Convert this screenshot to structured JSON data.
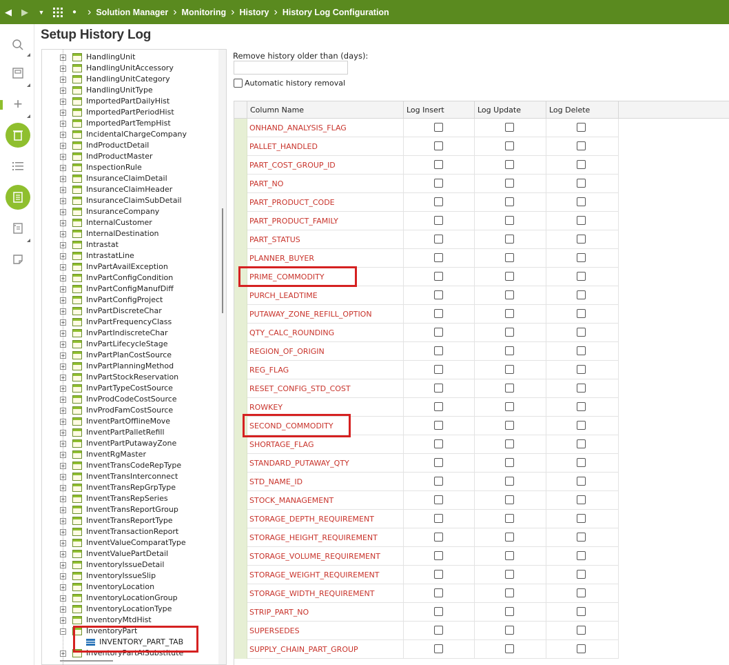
{
  "breadcrumb": [
    "Solution Manager",
    "Monitoring",
    "History",
    "History Log Configuration"
  ],
  "page_title": "Setup History Log",
  "tree": {
    "items": [
      "HandlingUnit",
      "HandlingUnitAccessory",
      "HandlingUnitCategory",
      "HandlingUnitType",
      "ImportedPartDailyHist",
      "ImportedPartPeriodHist",
      "ImportedPartTempHist",
      "IncidentalChargeCompany",
      "IndProductDetail",
      "IndProductMaster",
      "InspectionRule",
      "InsuranceClaimDetail",
      "InsuranceClaimHeader",
      "InsuranceClaimSubDetail",
      "InsuranceCompany",
      "InternalCustomer",
      "InternalDestination",
      "Intrastat",
      "IntrastatLine",
      "InvPartAvailException",
      "InvPartConfigCondition",
      "InvPartConfigManufDiff",
      "InvPartConfigProject",
      "InvPartDiscreteChar",
      "InvPartFrequencyClass",
      "InvPartIndiscreteChar",
      "InvPartLifecycleStage",
      "InvPartPlanCostSource",
      "InvPartPlanningMethod",
      "InvPartStockReservation",
      "InvPartTypeCostSource",
      "InvProdCodeCostSource",
      "InvProdFamCostSource",
      "InventPartOfflineMove",
      "InventPartPalletRefill",
      "InventPartPutawayZone",
      "InventRgMaster",
      "InventTransCodeRepType",
      "InventTransInterconnect",
      "InventTransRepGrpType",
      "InventTransRepSeries",
      "InventTransReportGroup",
      "InventTransReportType",
      "InventTransactionReport",
      "InventValueComparatType",
      "InventValuePartDetail",
      "InventoryIssueDetail",
      "InventoryIssueSlip",
      "InventoryLocation",
      "InventoryLocationGroup",
      "InventoryLocationType",
      "InventoryMtdHist",
      "InventoryPart"
    ],
    "child_item": "INVENTORY_PART_TAB",
    "cut_item": "InventoryPartAlSubstitute"
  },
  "settings": {
    "days_label": "Remove history older than (days):",
    "days_value": "",
    "auto_removal_label": "Automatic history removal"
  },
  "grid": {
    "headers": [
      "Column Name",
      "Log Insert",
      "Log Update",
      "Log Delete"
    ],
    "rows": [
      "ONHAND_ANALYSIS_FLAG",
      "PALLET_HANDLED",
      "PART_COST_GROUP_ID",
      "PART_NO",
      "PART_PRODUCT_CODE",
      "PART_PRODUCT_FAMILY",
      "PART_STATUS",
      "PLANNER_BUYER",
      "PRIME_COMMODITY",
      "PURCH_LEADTIME",
      "PUTAWAY_ZONE_REFILL_OPTION",
      "QTY_CALC_ROUNDING",
      "REGION_OF_ORIGIN",
      "REG_FLAG",
      "RESET_CONFIG_STD_COST",
      "ROWKEY",
      "SECOND_COMMODITY",
      "SHORTAGE_FLAG",
      "STANDARD_PUTAWAY_QTY",
      "STD_NAME_ID",
      "STOCK_MANAGEMENT",
      "STORAGE_DEPTH_REQUIREMENT",
      "STORAGE_HEIGHT_REQUIREMENT",
      "STORAGE_VOLUME_REQUIREMENT",
      "STORAGE_WEIGHT_REQUIREMENT",
      "STORAGE_WIDTH_REQUIREMENT",
      "STRIP_PART_NO",
      "SUPERSEDES",
      "SUPPLY_CHAIN_PART_GROUP"
    ]
  },
  "colors": {
    "header_green": "#5a8a1f",
    "accent_green": "#8fbf2e",
    "column_name_red": "#c8332b",
    "highlight_red": "#d52121"
  }
}
